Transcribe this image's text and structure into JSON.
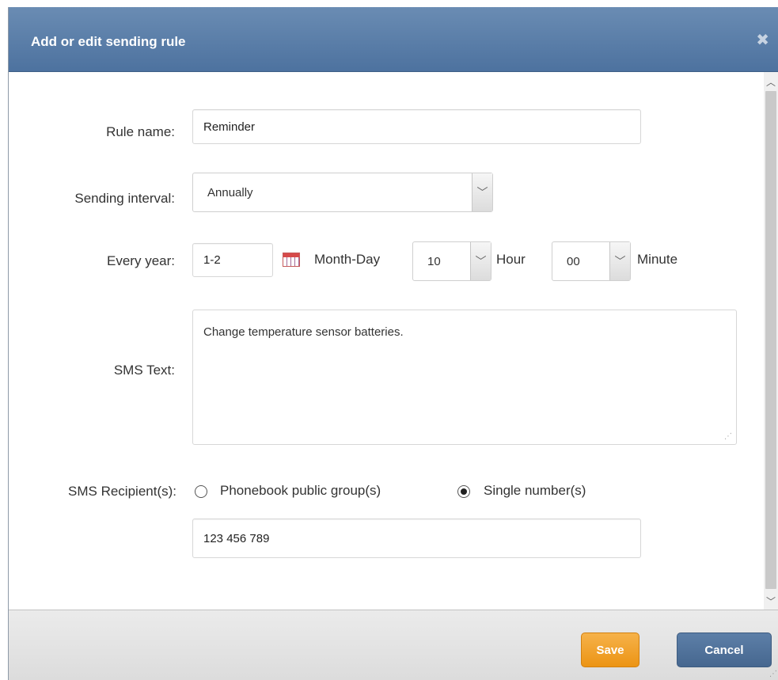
{
  "dialog": {
    "title": "Add or edit sending rule",
    "close_symbol": "✖"
  },
  "form": {
    "rule_name": {
      "label": "Rule name:",
      "value": "Reminder"
    },
    "sending_interval": {
      "label": "Sending interval:",
      "value": "Annually"
    },
    "every_year": {
      "label": "Every year:",
      "date_value": "1-2",
      "date_suffix": "Month-Day",
      "hour_value": "10",
      "hour_suffix": "Hour",
      "minute_value": "00",
      "minute_suffix": "Minute"
    },
    "sms_text": {
      "label": "SMS Text:",
      "value": "Change temperature sensor batteries."
    },
    "sms_recipients": {
      "label": "SMS Recipient(s):",
      "option_group": "Phonebook public group(s)",
      "option_single": "Single number(s)",
      "selected": "single",
      "number_value": "123 456 789"
    }
  },
  "footer": {
    "save_label": "Save",
    "cancel_label": "Cancel"
  },
  "icons": {
    "close": "close-icon",
    "calendar": "calendar-icon",
    "chevron": "chevron-down-icon"
  },
  "colors": {
    "titlebar": "#5a7ea9",
    "save": "#f0a02a",
    "cancel": "#4f719a"
  }
}
